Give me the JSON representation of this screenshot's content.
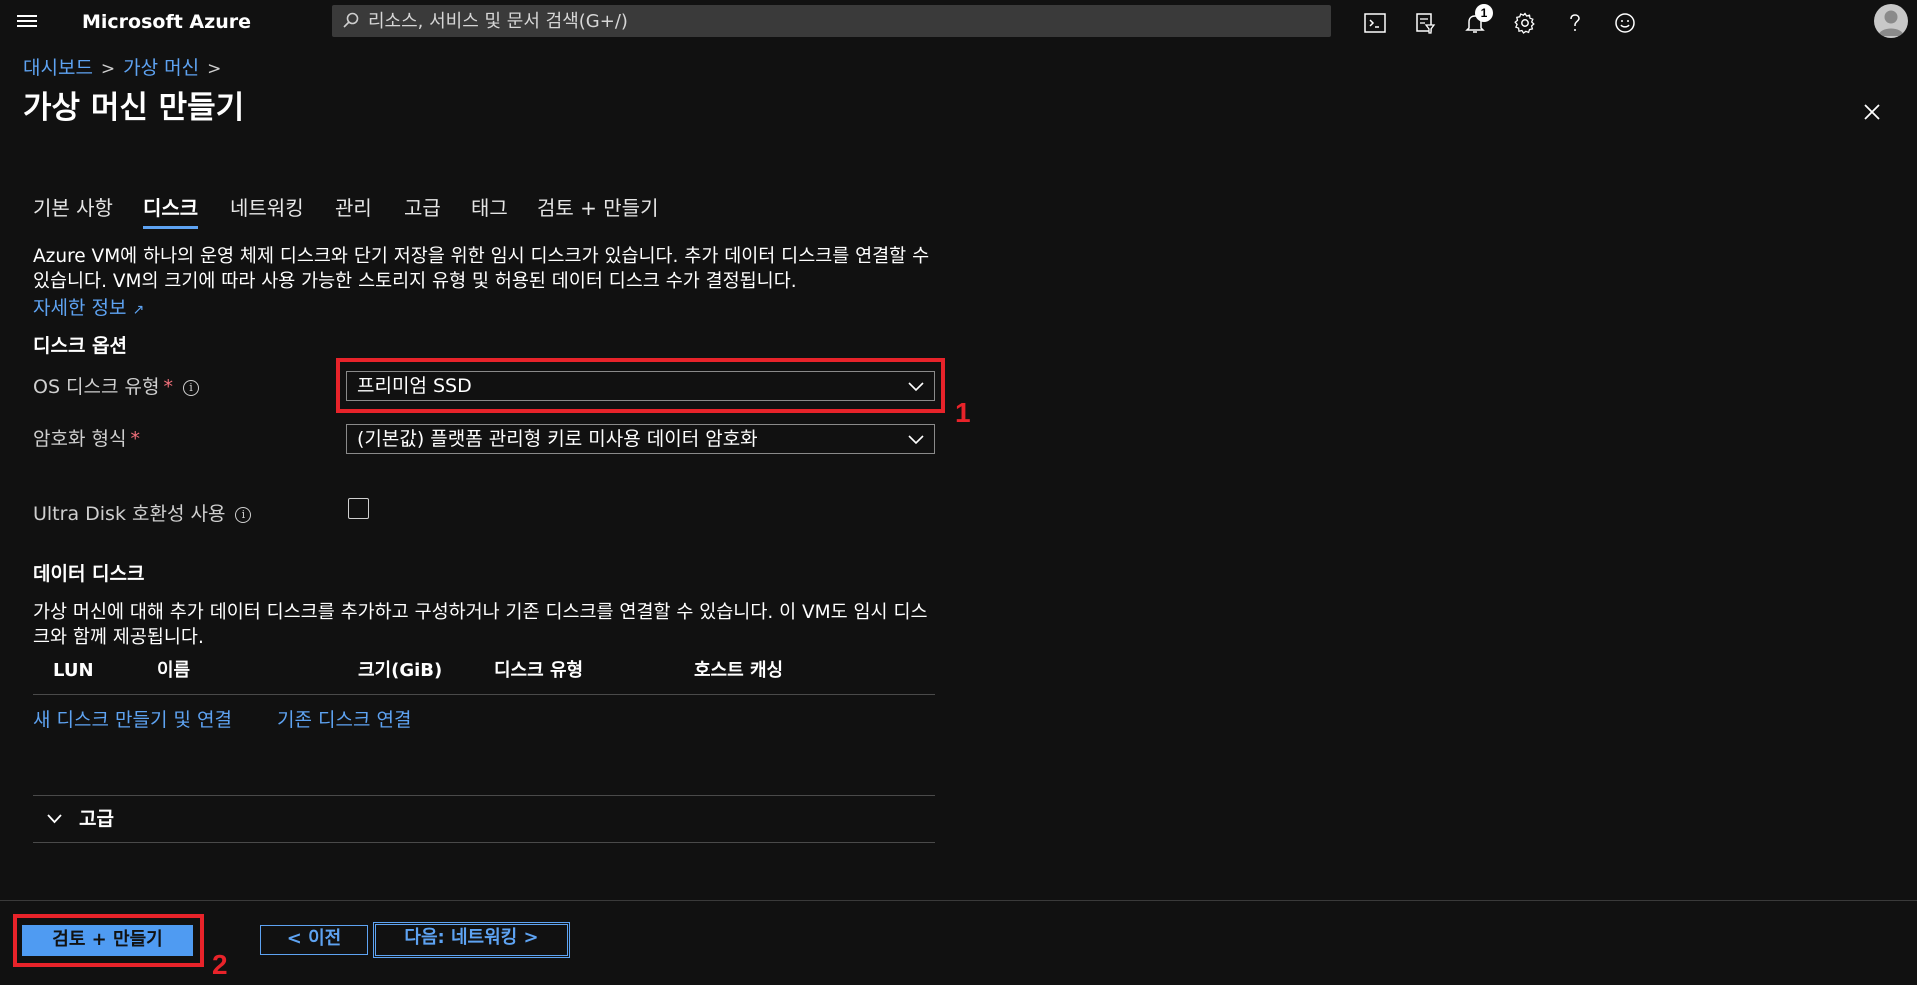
{
  "topbar": {
    "brand": "Microsoft Azure",
    "search_placeholder": "리소스, 서비스 및 문서 검색(G+/)",
    "notification_count": "1",
    "icons": [
      "menu-icon",
      "cloud-shell-icon",
      "directory-filter-icon",
      "notification-icon",
      "settings-icon",
      "help-icon",
      "feedback-icon",
      "avatar"
    ]
  },
  "breadcrumb": {
    "items": [
      "대시보드",
      "가상 머신"
    ],
    "separator": ">"
  },
  "page_title": "가상 머신 만들기",
  "tabs": [
    {
      "label": "기본 사항",
      "active": false
    },
    {
      "label": "디스크",
      "active": true
    },
    {
      "label": "네트워킹",
      "active": false
    },
    {
      "label": "관리",
      "active": false
    },
    {
      "label": "고급",
      "active": false
    },
    {
      "label": "태그",
      "active": false
    },
    {
      "label": "검토 + 만들기",
      "active": false
    }
  ],
  "intro": {
    "text": "Azure VM에 하나의 운영 체제 디스크와 단기 저장을 위한 임시 디스크가 있습니다. 추가 데이터 디스크를 연결할 수 있습니다. VM의 크기에 따라 사용 가능한 스토리지 유형 및 허용된 데이터 디스크 수가 결정됩니다.",
    "learn_more": "자세한 정보"
  },
  "disk_options": {
    "title": "디스크 옵션",
    "os_disk_type": {
      "label": "OS 디스크 유형",
      "required_mark": "*",
      "value": "프리미엄 SSD"
    },
    "encryption": {
      "label": "암호화 형식",
      "required_mark": "*",
      "value": "(기본값) 플랫폼 관리형 키로 미사용 데이터 암호화"
    },
    "ultra_disk": {
      "label": "Ultra Disk 호환성 사용",
      "checked": false
    }
  },
  "data_disks": {
    "title": "데이터 디스크",
    "description": "가상 머신에 대해 추가 데이터 디스크를 추가하고 구성하거나 기존 디스크를 연결할 수 있습니다. 이 VM도 임시 디스크와 함께 제공됩니다.",
    "columns": [
      "LUN",
      "이름",
      "크기(GiB)",
      "디스크 유형",
      "호스트 캐싱"
    ],
    "create_link": "새 디스크 만들기 및 연결",
    "attach_link": "기존 디스크 연결"
  },
  "advanced": {
    "label": "고급"
  },
  "footer": {
    "review_create": "검토 + 만들기",
    "previous": "< 이전",
    "next": "다음: 네트워킹 >"
  },
  "annotations": {
    "marker1": "1",
    "marker2": "2",
    "color": "#e8232a"
  },
  "colors": {
    "accent": "#5ea3f2",
    "background": "#111111",
    "primary_button": "#4f9bf2"
  }
}
